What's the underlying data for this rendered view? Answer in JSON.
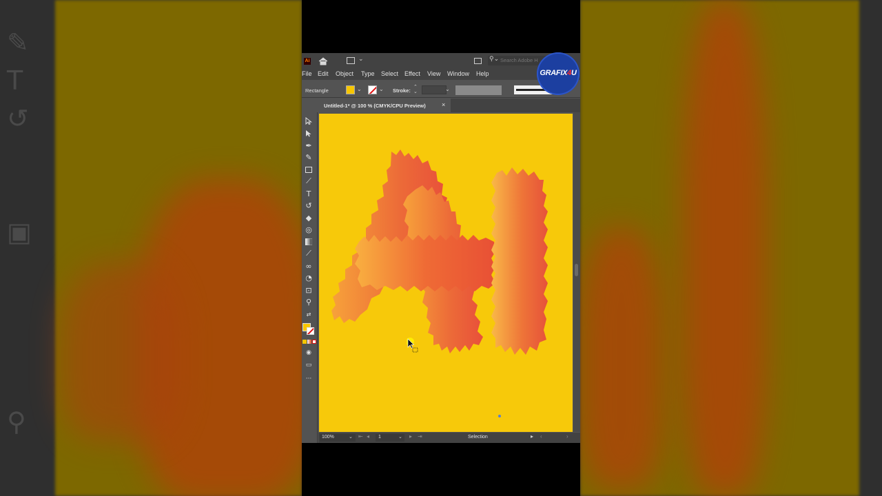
{
  "app": {
    "logo_text": "Ai",
    "search_placeholder": "Search Adobe H"
  },
  "menu": {
    "items": [
      "File",
      "Edit",
      "Object",
      "Type",
      "Select",
      "Effect",
      "View",
      "Window",
      "Help"
    ]
  },
  "control_bar": {
    "selection_label": "Rectangle",
    "stroke_label": "Stroke:"
  },
  "document": {
    "tab_title": "Untitled-1* @ 100 % (CMYK/CPU Preview)",
    "close_glyph": "×"
  },
  "status_bar": {
    "zoom": "100%",
    "artboard_number": "1",
    "tool_status": "Selection"
  },
  "colors": {
    "fill": "#f7c600",
    "artboard": "#f7c90a",
    "fur_light": "#f7a23a",
    "fur_dark": "#e8503a",
    "ui_panel": "#535353"
  },
  "artwork": {
    "description_letters": "AI",
    "style": "fur"
  },
  "watermark": {
    "brand_prefix": "GRAFIX",
    "brand_number": "4",
    "brand_suffix": "U"
  },
  "tools": [
    "selection-tool-icon",
    "direct-selection-tool-icon",
    "pen-tool-icon",
    "curvature-tool-icon",
    "rectangle-tool-icon",
    "paintbrush-tool-icon",
    "type-tool-icon",
    "rotate-tool-icon",
    "eraser-tool-icon",
    "lasso-tool-icon",
    "gradient-tool-icon",
    "eyedropper-tool-icon",
    "blend-tool-icon",
    "shape-builder-tool-icon",
    "artboard-tool-icon",
    "zoom-tool-icon"
  ]
}
